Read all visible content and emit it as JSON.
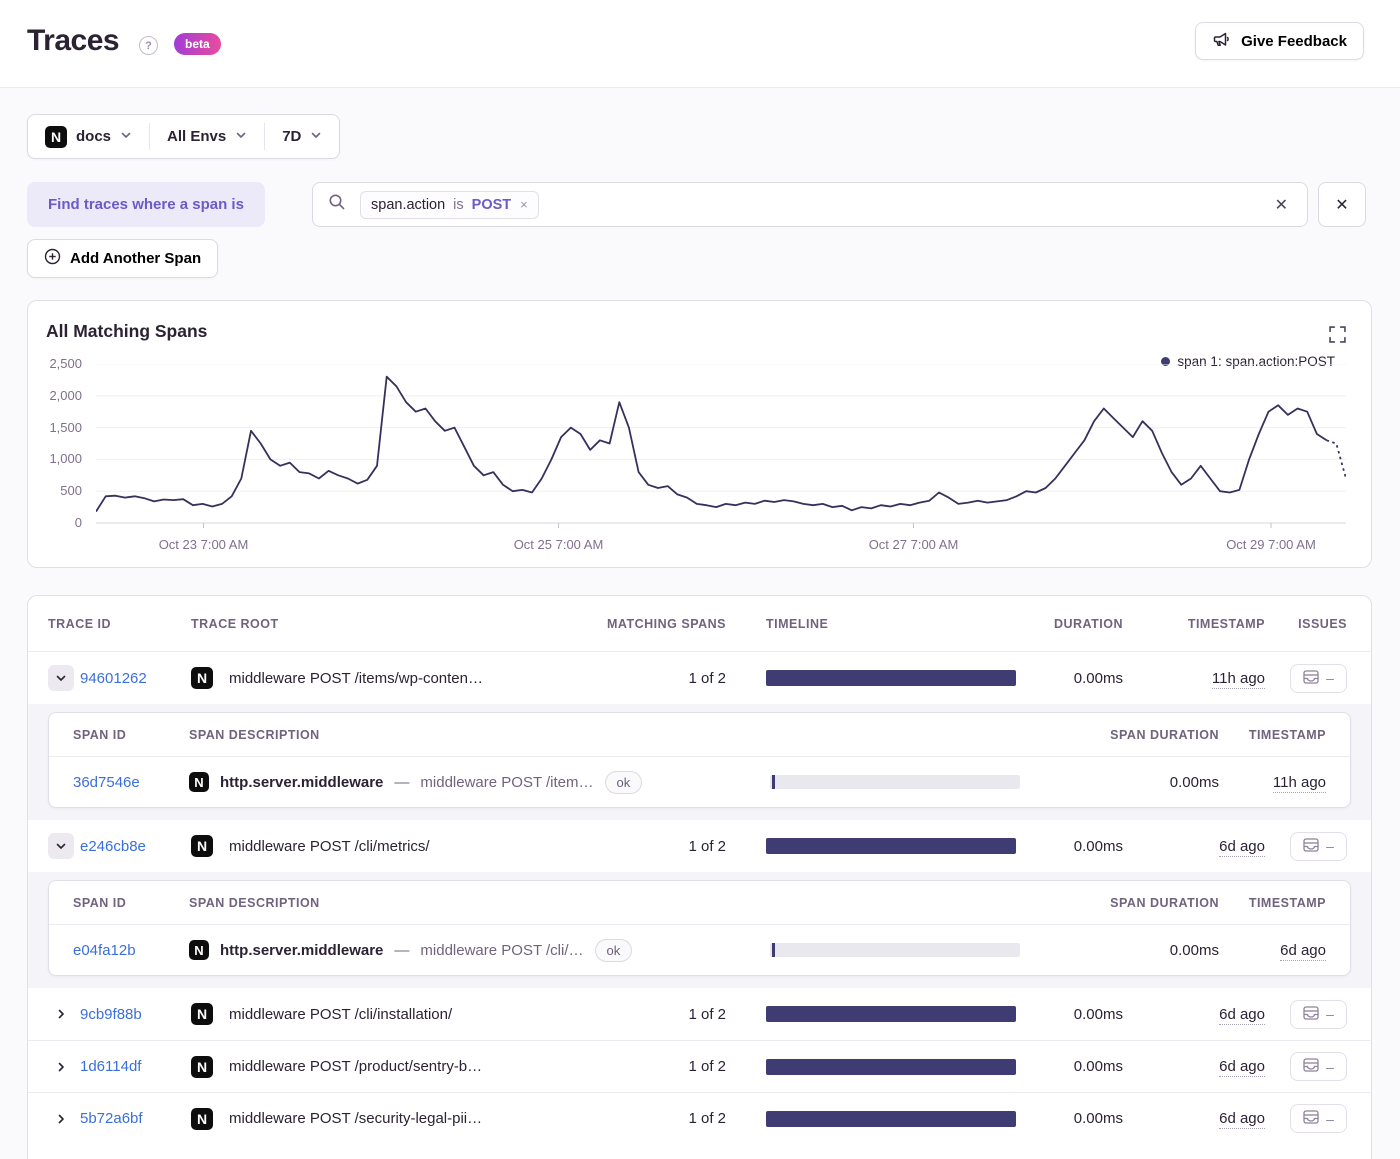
{
  "header": {
    "title": "Traces",
    "help_glyph": "?",
    "beta_label": "beta",
    "feedback_label": "Give Feedback"
  },
  "filters": {
    "project_label": "docs",
    "project_logo_letter": "N",
    "env_label": "All Envs",
    "date_range_label": "7D"
  },
  "span_filter": {
    "prefix_label": "Find traces where a span is",
    "token_key": "span.action",
    "token_op": "is",
    "token_value": "POST",
    "token_remove_glyph": "×",
    "clear_glyph": "✕",
    "close_glyph": "✕",
    "add_button_label": "Add Another Span"
  },
  "chart": {
    "title": "All Matching Spans",
    "legend_label": "span 1: span.action:POST"
  },
  "chart_data": {
    "type": "line",
    "title": "All Matching Spans",
    "legend_entries": [
      "span 1: span.action:POST"
    ],
    "legend_position": "top-right",
    "grid": "horizontal",
    "ylim": [
      0,
      2500
    ],
    "y_ticks": [
      0,
      500,
      1000,
      1500,
      2000,
      2500
    ],
    "x_tick_labels": [
      "Oct 23 7:00 AM",
      "Oct 25 7:00 AM",
      "Oct 27 7:00 AM",
      "Oct 29 7:00 AM"
    ],
    "x_tick_positions": [
      0.086,
      0.37,
      0.654,
      0.94
    ],
    "line_color": "#35315C",
    "dashed_tail_points": 2,
    "series": [
      {
        "name": "span 1: span.action:POST",
        "values": [
          180,
          420,
          430,
          400,
          420,
          390,
          340,
          370,
          360,
          375,
          280,
          300,
          260,
          300,
          420,
          700,
          1450,
          1250,
          1000,
          900,
          950,
          800,
          780,
          700,
          820,
          750,
          700,
          620,
          680,
          900,
          2300,
          2150,
          1900,
          1750,
          1800,
          1600,
          1450,
          1500,
          1200,
          900,
          750,
          800,
          600,
          500,
          520,
          480,
          700,
          1000,
          1350,
          1500,
          1400,
          1150,
          1300,
          1250,
          1900,
          1500,
          800,
          600,
          550,
          580,
          450,
          400,
          300,
          280,
          250,
          300,
          280,
          320,
          300,
          350,
          330,
          360,
          340,
          300,
          280,
          300,
          250,
          270,
          200,
          250,
          230,
          280,
          260,
          300,
          280,
          320,
          350,
          480,
          400,
          300,
          320,
          350,
          320,
          340,
          360,
          420,
          500,
          480,
          550,
          700,
          900,
          1100,
          1300,
          1600,
          1800,
          1650,
          1500,
          1350,
          1600,
          1450,
          1100,
          800,
          600,
          700,
          900,
          700,
          500,
          480,
          520,
          1000,
          1400,
          1750,
          1850,
          1700,
          1800,
          1750,
          1400,
          1300,
          1250,
          700
        ]
      }
    ]
  },
  "colors": {
    "accent_purple": "#6A5BC7",
    "link_blue": "#3B6FDB",
    "bar_navy": "#3E3C72",
    "line_navy": "#35315C"
  },
  "table": {
    "headers": {
      "trace_id": "TRACE ID",
      "trace_root": "TRACE ROOT",
      "matching_spans": "MATCHING SPANS",
      "timeline": "TIMELINE",
      "duration": "DURATION",
      "timestamp": "TIMESTAMP",
      "issues": "ISSUES"
    },
    "sub_headers": {
      "span_id": "SPAN ID",
      "span_description": "SPAN DESCRIPTION",
      "span_duration": "SPAN DURATION",
      "timestamp": "TIMESTAMP"
    },
    "issues_placeholder": "–",
    "rows": [
      {
        "trace_id": "94601262",
        "root": "middleware POST /items/wp-conten…",
        "matching": "1 of 2",
        "timeline_fraction": 1,
        "duration": "0.00ms",
        "timestamp": "11h ago",
        "expanded": true
      },
      {
        "trace_id": "e246cb8e",
        "root": "middleware POST /cli/metrics/",
        "matching": "1 of 2",
        "timeline_fraction": 1,
        "duration": "0.00ms",
        "timestamp": "6d ago",
        "expanded": true
      },
      {
        "trace_id": "9cb9f88b",
        "root": "middleware POST /cli/installation/",
        "matching": "1 of 2",
        "timeline_fraction": 1,
        "duration": "0.00ms",
        "timestamp": "6d ago",
        "expanded": false
      },
      {
        "trace_id": "1d6114df",
        "root": "middleware POST /product/sentry-b…",
        "matching": "1 of 2",
        "timeline_fraction": 1,
        "duration": "0.00ms",
        "timestamp": "6d ago",
        "expanded": false
      },
      {
        "trace_id": "5b72a6bf",
        "root": "middleware POST /security-legal-pii…",
        "matching": "1 of 2",
        "timeline_fraction": 1,
        "duration": "0.00ms",
        "timestamp": "6d ago",
        "expanded": false
      }
    ],
    "span_rows": [
      {
        "span_id": "36d7546e",
        "op": "http.server.middleware",
        "separator": "—",
        "description": "middleware POST /item…",
        "status": "ok",
        "duration": "0.00ms",
        "timestamp": "11h ago"
      },
      {
        "span_id": "e04fa12b",
        "op": "http.server.middleware",
        "separator": "—",
        "description": "middleware POST /cli/…",
        "status": "ok",
        "duration": "0.00ms",
        "timestamp": "6d ago"
      }
    ]
  }
}
